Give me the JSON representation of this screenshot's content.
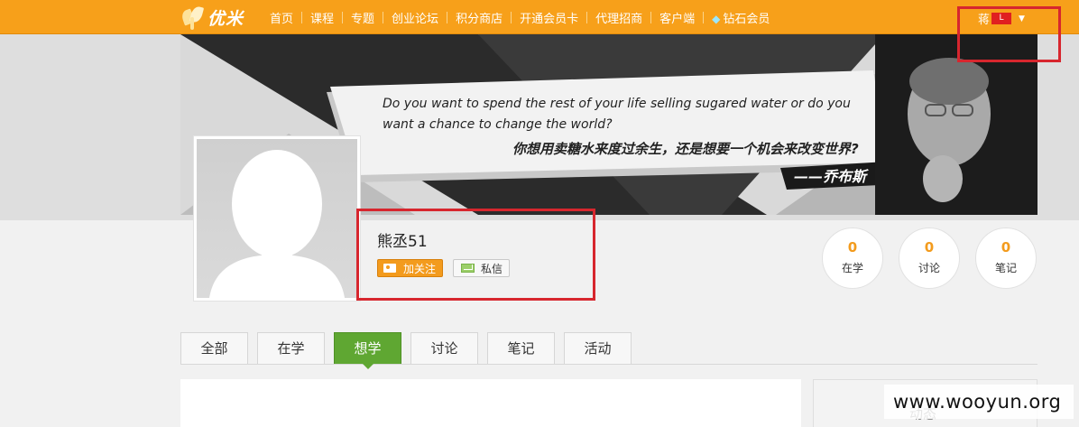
{
  "topbar": {
    "logo_text": "优米",
    "nav": [
      {
        "label": "首页"
      },
      {
        "label": "课程"
      },
      {
        "label": "专题"
      },
      {
        "label": "创业论坛"
      },
      {
        "label": "积分商店"
      },
      {
        "label": "开通会员卡"
      },
      {
        "label": "代理招商"
      },
      {
        "label": "客户端"
      },
      {
        "label": "钻石会员",
        "icon": "diamond-icon"
      }
    ],
    "user_name": "蒋",
    "user_badge": "L"
  },
  "banner": {
    "quote_en": "Do you want to spend the rest of your life selling sugared water or do you want a chance to change the world?",
    "quote_cn": "你想用卖糖水来度过余生，还是想要一个机会来改变世界?",
    "quote_author": "——乔布斯"
  },
  "profile": {
    "username": "熊丞51",
    "follow_label": "加关注",
    "message_label": "私信"
  },
  "stats": [
    {
      "value": "0",
      "label": "在学"
    },
    {
      "value": "0",
      "label": "讨论"
    },
    {
      "value": "0",
      "label": "笔记"
    }
  ],
  "tabs": [
    {
      "label": "全部"
    },
    {
      "label": "在学"
    },
    {
      "label": "想学",
      "active": true
    },
    {
      "label": "讨论"
    },
    {
      "label": "笔记"
    },
    {
      "label": "活动"
    }
  ],
  "sidebar": {
    "title": "动态"
  },
  "watermark": "www.wooyun.org",
  "colors": {
    "brand_orange": "#f7a01a",
    "active_green": "#5fa732",
    "annotation_red": "#d7262e"
  }
}
